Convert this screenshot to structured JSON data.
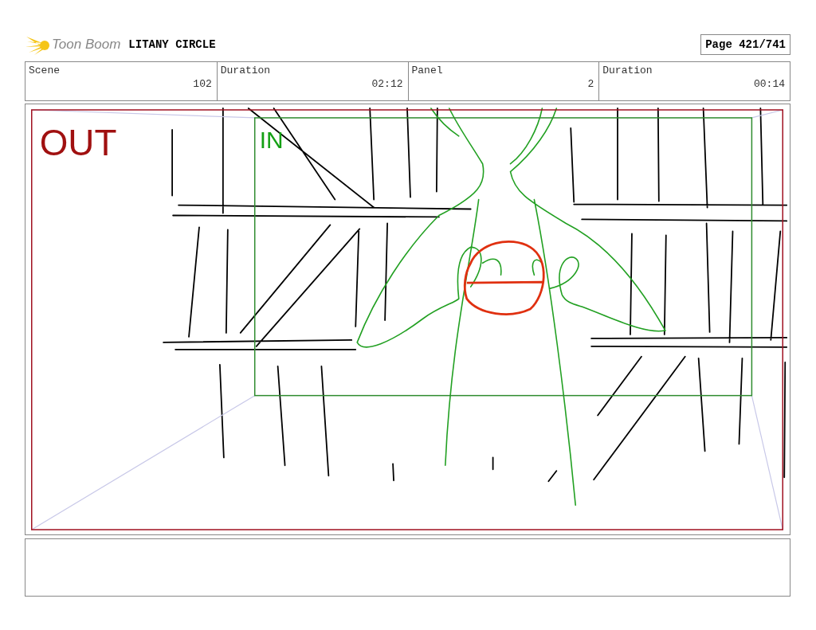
{
  "header": {
    "logo": "Toon Boom",
    "title": "LITANY CIRCLE",
    "page": "Page 421/741"
  },
  "info_table": {
    "columns": [
      "Scene",
      "Duration",
      "Panel",
      "Duration"
    ],
    "rows": [
      [
        "102",
        "02:12",
        "2",
        "00:14"
      ]
    ]
  },
  "panel": {
    "frames": [
      {
        "kind": "out",
        "label": "OUT"
      },
      {
        "kind": "in",
        "label": "IN"
      }
    ]
  }
}
